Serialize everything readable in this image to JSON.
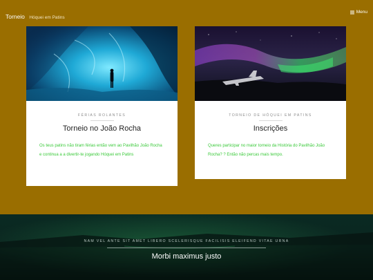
{
  "header": {
    "site_title": "Torneio",
    "tagline": "Hóquei em Patins",
    "menu_label": "Menu",
    "menu_icon": "hamburger-icon"
  },
  "cards": [
    {
      "category": "FÉRIAS ROLANTES",
      "title": "Torneio no João Rocha",
      "excerpt": "Os teus patins não tiram férias então vem ao Pavilhão João Rocha e continua a a divertir-te jogando Hóquei em Patins",
      "image": "ice-cave-silhouette"
    },
    {
      "category": "TORNEIO DE HÓQUEI EM PATINS",
      "title": "Inscrições",
      "excerpt": "Queres participar no maior torneio da História do Pavilhão João Rocha? ? Então não percas mais tempo.",
      "image": "aurora-plane-wreck"
    }
  ],
  "hero": {
    "kicker": "NAM VEL ANTE SIT AMET LIBERO SCELERISQUE FACILISIS ELEIFEND VITAE URNA",
    "title": "Morbi maximus justo",
    "image": "night-lake-reflection"
  },
  "colors": {
    "background": "#9a6e00",
    "card": "#ffffff",
    "excerpt_text": "#3ac93a",
    "hero_bg": "#071a16"
  }
}
